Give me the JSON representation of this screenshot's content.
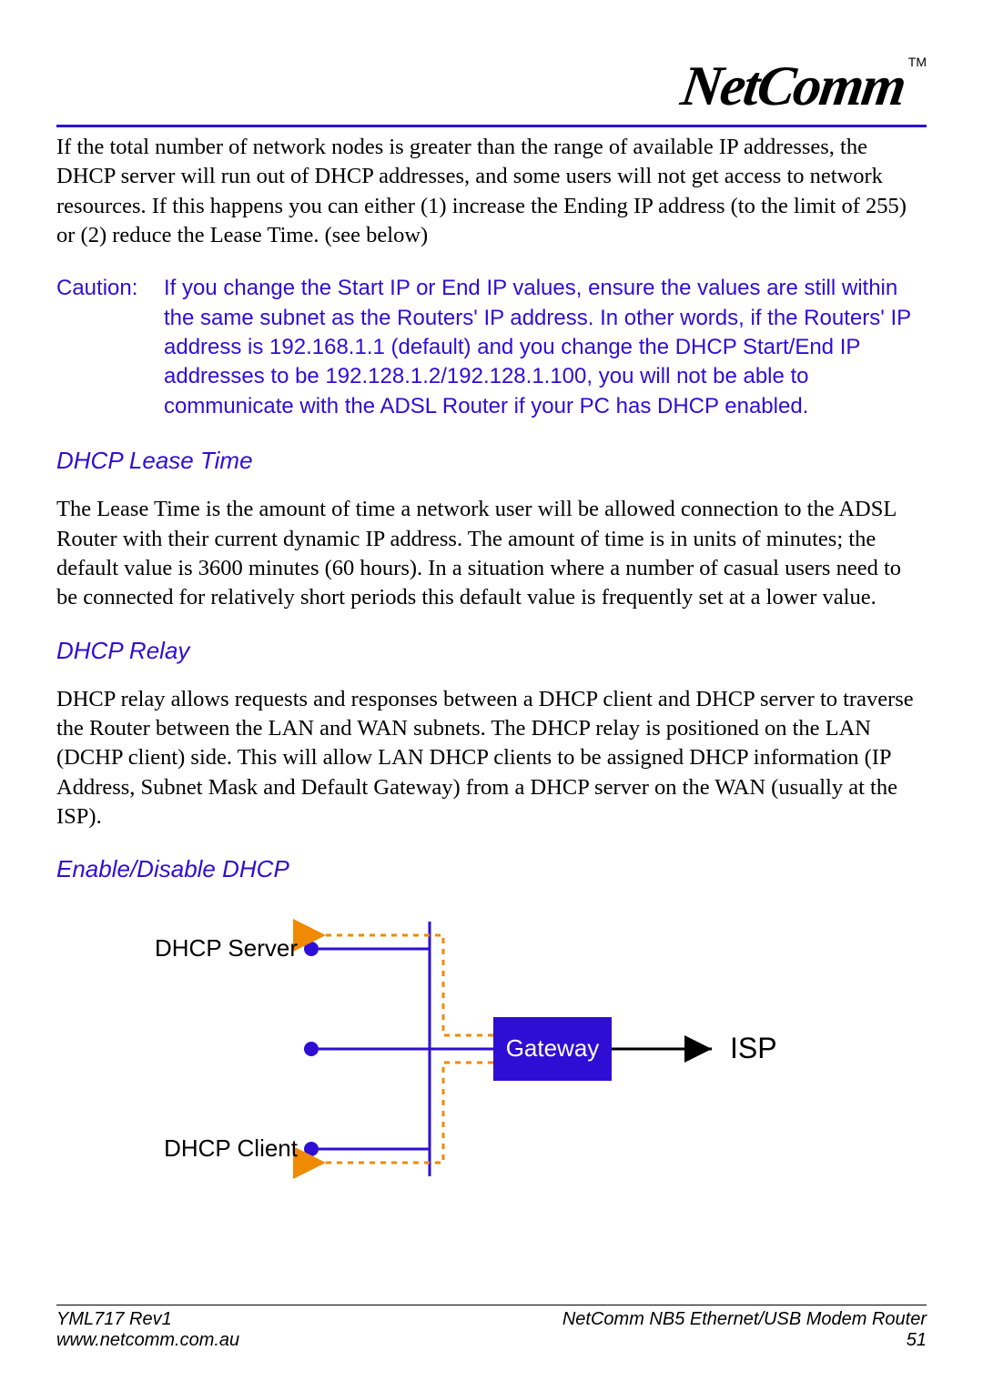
{
  "logo": {
    "text": "NetComm",
    "tm": "TM"
  },
  "intro_paragraph": "If the total number of network nodes is greater than the range of available IP addresses, the DHCP server will run out of DHCP addresses, and some users will not get access to network resources. If this happens you can either (1) increase the Ending IP address (to the limit of 255) or (2) reduce the Lease Time. (see below)",
  "caution": {
    "label": "Caution:",
    "text": "If you change the Start IP or End IP values, ensure the values are still within the same subnet as the Routers' IP address. In other words, if the Routers' IP address is 192.168.1.1 (default) and you change the DHCP Start/End IP addresses to be 192.128.1.2/192.128.1.100, you will not be able to communicate with the ADSL Router if your PC has DHCP enabled."
  },
  "sections": {
    "lease_time": {
      "heading": "DHCP Lease Time",
      "body": "The Lease Time is the amount of time a network user will be allowed connection to the ADSL Router with their current dynamic IP address. The amount of time is in units of minutes; the default value is 3600 minutes (60 hours). In a situation where a number of casual users need to be connected for relatively short periods this default value is frequently set at a lower value."
    },
    "relay": {
      "heading": "DHCP Relay",
      "body": "DHCP relay allows requests and responses between a DHCP client and DHCP server to traverse the Router between the LAN and WAN subnets. The DHCP relay is positioned on the LAN (DCHP client) side. This will allow LAN DHCP clients to be assigned DHCP information (IP Address, Subnet Mask and Default Gateway) from a DHCP server on the WAN (usually at the ISP)."
    },
    "enable": {
      "heading": "Enable/Disable DHCP"
    }
  },
  "diagram": {
    "server_label": "DHCP Server",
    "client_label": "DHCP Client",
    "gateway_label": "Gateway",
    "isp_label": "ISP"
  },
  "footer": {
    "rev": "YML717 Rev1",
    "url": "www.netcomm.com.au",
    "product": "NetComm NB5 Ethernet/USB Modem Router",
    "page": "51"
  }
}
